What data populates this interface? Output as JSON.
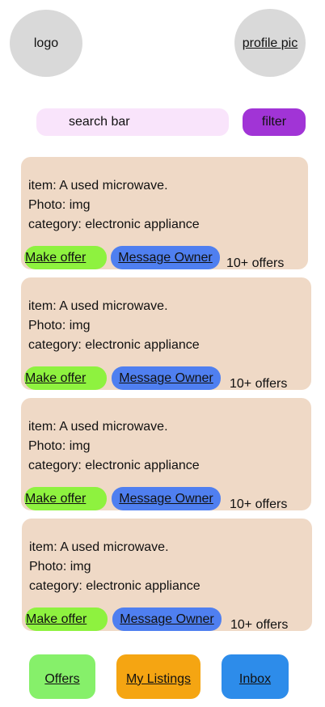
{
  "header": {
    "logo_label": "logo",
    "profile_label": "profile pic"
  },
  "search": {
    "placeholder": "search bar",
    "filter_label": "filter"
  },
  "listings": [
    {
      "item_line": "item:  A used microwave.",
      "photo_line": "Photo: img",
      "category_line": "category:  electronic appliance",
      "offer_label": "Make offer",
      "message_label": "Message Owner",
      "offers_count": "10+ offers"
    },
    {
      "item_line": "item:  A used microwave.",
      "photo_line": "Photo: img",
      "category_line": "category:  electronic appliance",
      "offer_label": "Make offer",
      "message_label": "Message Owner",
      "offers_count": "10+ offers"
    },
    {
      "item_line": "item:  A used microwave.",
      "photo_line": "Photo: img",
      "category_line": "category:  electronic appliance",
      "offer_label": "Make offer",
      "message_label": "Message Owner",
      "offers_count": "10+ offers"
    },
    {
      "item_line": "item:  A used microwave.",
      "photo_line": "Photo: img",
      "category_line": "category:  electronic appliance",
      "offer_label": "Make offer",
      "message_label": "Message Owner",
      "offers_count": "10+ offers"
    }
  ],
  "bottom_nav": {
    "offers_label": "Offers",
    "listings_label": "My Listings",
    "inbox_label": "Inbox"
  },
  "colors": {
    "card_bg": "#efd9c6",
    "make_offer": "#8ef23f",
    "message_owner": "#4f7ff0",
    "filter": "#a134d6",
    "search_bg": "#f9e4fb",
    "nav_offers": "#86f06a",
    "nav_listings": "#f5a512",
    "nav_inbox": "#2d8cea"
  }
}
